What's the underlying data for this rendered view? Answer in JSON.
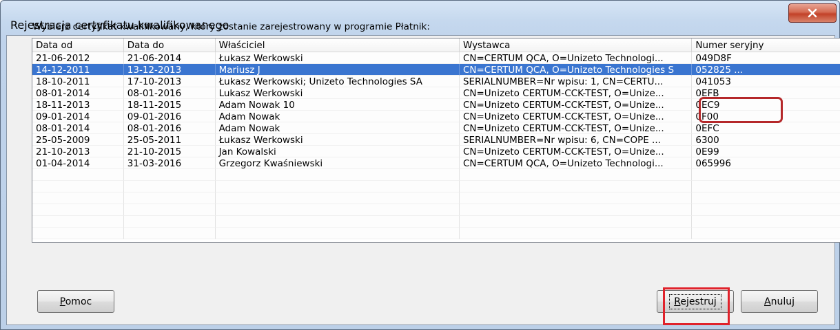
{
  "window": {
    "title": "Rejestracja certyfikatu kwalifikowanego",
    "close_glyph": "X"
  },
  "prompt": "Wybierz certyfikat kwalifikowany, który zostanie zarejestrowany w programie Płatnik:",
  "columns": [
    "Data od",
    "Data do",
    "Właściciel",
    "Wystawca",
    "Numer seryjny"
  ],
  "rows": [
    [
      "21-06-2012",
      "21-06-2014",
      "Łukasz Werkowski",
      "CN=CERTUM QCA, O=Unizeto Technologi...",
      "049D8F"
    ],
    [
      "14-12-2011",
      "13-12-2013",
      "Mariusz J",
      "CN=CERTUM QCA, O=Unizeto Technologies S",
      "052825 ..."
    ],
    [
      "18-10-2011",
      "17-10-2013",
      "Łukasz Werkowski; Unizeto Technologies SA",
      "SERIALNUMBER=Nr wpisu: 1, CN=CERTU...",
      "041053"
    ],
    [
      "08-01-2014",
      "08-01-2016",
      "Lukasz Werkowski",
      "CN=Unizeto CERTUM-CCK-TEST, O=Unize...",
      "0EFB"
    ],
    [
      "18-11-2013",
      "18-11-2015",
      "Adam Nowak 10",
      "CN=Unizeto CERTUM-CCK-TEST, O=Unize...",
      "0EC9"
    ],
    [
      "09-01-2014",
      "09-01-2016",
      "Adam Nowak",
      "CN=Unizeto CERTUM-CCK-TEST, O=Unize...",
      "0F00"
    ],
    [
      "08-01-2014",
      "08-01-2016",
      "Adam Nowak",
      "CN=Unizeto CERTUM-CCK-TEST, O=Unize...",
      "0EFC"
    ],
    [
      "25-05-2009",
      "25-05-2011",
      "Łukasz Werkowski",
      "SERIALNUMBER=Nr wpisu: 6, CN=COPE ...",
      "6300"
    ],
    [
      "21-10-2013",
      "21-10-2015",
      "Jan Kowalski",
      "CN=Unizeto CERTUM-CCK-TEST, O=Unize...",
      "0E99"
    ],
    [
      "01-04-2014",
      "31-03-2016",
      "Grzegorz Kwaśniewski",
      "CN=CERTUM QCA, O=Unizeto Technologi...",
      "065996"
    ]
  ],
  "selected_row": 1,
  "buttons": {
    "help_label": "Pomoc",
    "register_label": "Rejestruj",
    "cancel_label": "Anuluj"
  },
  "colors": {
    "selection": "#3a75d0",
    "highlight": "#e0222b"
  }
}
